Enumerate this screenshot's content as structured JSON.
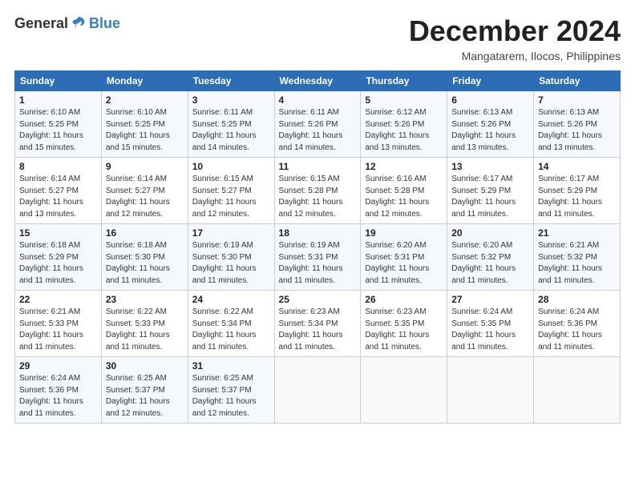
{
  "logo": {
    "general": "General",
    "blue": "Blue"
  },
  "title": "December 2024",
  "location": "Mangatarem, Ilocos, Philippines",
  "weekdays": [
    "Sunday",
    "Monday",
    "Tuesday",
    "Wednesday",
    "Thursday",
    "Friday",
    "Saturday"
  ],
  "weeks": [
    [
      {
        "day": "1",
        "info": "Sunrise: 6:10 AM\nSunset: 5:25 PM\nDaylight: 11 hours\nand 15 minutes."
      },
      {
        "day": "2",
        "info": "Sunrise: 6:10 AM\nSunset: 5:25 PM\nDaylight: 11 hours\nand 15 minutes."
      },
      {
        "day": "3",
        "info": "Sunrise: 6:11 AM\nSunset: 5:25 PM\nDaylight: 11 hours\nand 14 minutes."
      },
      {
        "day": "4",
        "info": "Sunrise: 6:11 AM\nSunset: 5:26 PM\nDaylight: 11 hours\nand 14 minutes."
      },
      {
        "day": "5",
        "info": "Sunrise: 6:12 AM\nSunset: 5:26 PM\nDaylight: 11 hours\nand 13 minutes."
      },
      {
        "day": "6",
        "info": "Sunrise: 6:13 AM\nSunset: 5:26 PM\nDaylight: 11 hours\nand 13 minutes."
      },
      {
        "day": "7",
        "info": "Sunrise: 6:13 AM\nSunset: 5:26 PM\nDaylight: 11 hours\nand 13 minutes."
      }
    ],
    [
      {
        "day": "8",
        "info": "Sunrise: 6:14 AM\nSunset: 5:27 PM\nDaylight: 11 hours\nand 13 minutes."
      },
      {
        "day": "9",
        "info": "Sunrise: 6:14 AM\nSunset: 5:27 PM\nDaylight: 11 hours\nand 12 minutes."
      },
      {
        "day": "10",
        "info": "Sunrise: 6:15 AM\nSunset: 5:27 PM\nDaylight: 11 hours\nand 12 minutes."
      },
      {
        "day": "11",
        "info": "Sunrise: 6:15 AM\nSunset: 5:28 PM\nDaylight: 11 hours\nand 12 minutes."
      },
      {
        "day": "12",
        "info": "Sunrise: 6:16 AM\nSunset: 5:28 PM\nDaylight: 11 hours\nand 12 minutes."
      },
      {
        "day": "13",
        "info": "Sunrise: 6:17 AM\nSunset: 5:29 PM\nDaylight: 11 hours\nand 11 minutes."
      },
      {
        "day": "14",
        "info": "Sunrise: 6:17 AM\nSunset: 5:29 PM\nDaylight: 11 hours\nand 11 minutes."
      }
    ],
    [
      {
        "day": "15",
        "info": "Sunrise: 6:18 AM\nSunset: 5:29 PM\nDaylight: 11 hours\nand 11 minutes."
      },
      {
        "day": "16",
        "info": "Sunrise: 6:18 AM\nSunset: 5:30 PM\nDaylight: 11 hours\nand 11 minutes."
      },
      {
        "day": "17",
        "info": "Sunrise: 6:19 AM\nSunset: 5:30 PM\nDaylight: 11 hours\nand 11 minutes."
      },
      {
        "day": "18",
        "info": "Sunrise: 6:19 AM\nSunset: 5:31 PM\nDaylight: 11 hours\nand 11 minutes."
      },
      {
        "day": "19",
        "info": "Sunrise: 6:20 AM\nSunset: 5:31 PM\nDaylight: 11 hours\nand 11 minutes."
      },
      {
        "day": "20",
        "info": "Sunrise: 6:20 AM\nSunset: 5:32 PM\nDaylight: 11 hours\nand 11 minutes."
      },
      {
        "day": "21",
        "info": "Sunrise: 6:21 AM\nSunset: 5:32 PM\nDaylight: 11 hours\nand 11 minutes."
      }
    ],
    [
      {
        "day": "22",
        "info": "Sunrise: 6:21 AM\nSunset: 5:33 PM\nDaylight: 11 hours\nand 11 minutes."
      },
      {
        "day": "23",
        "info": "Sunrise: 6:22 AM\nSunset: 5:33 PM\nDaylight: 11 hours\nand 11 minutes."
      },
      {
        "day": "24",
        "info": "Sunrise: 6:22 AM\nSunset: 5:34 PM\nDaylight: 11 hours\nand 11 minutes."
      },
      {
        "day": "25",
        "info": "Sunrise: 6:23 AM\nSunset: 5:34 PM\nDaylight: 11 hours\nand 11 minutes."
      },
      {
        "day": "26",
        "info": "Sunrise: 6:23 AM\nSunset: 5:35 PM\nDaylight: 11 hours\nand 11 minutes."
      },
      {
        "day": "27",
        "info": "Sunrise: 6:24 AM\nSunset: 5:35 PM\nDaylight: 11 hours\nand 11 minutes."
      },
      {
        "day": "28",
        "info": "Sunrise: 6:24 AM\nSunset: 5:36 PM\nDaylight: 11 hours\nand 11 minutes."
      }
    ],
    [
      {
        "day": "29",
        "info": "Sunrise: 6:24 AM\nSunset: 5:36 PM\nDaylight: 11 hours\nand 11 minutes."
      },
      {
        "day": "30",
        "info": "Sunrise: 6:25 AM\nSunset: 5:37 PM\nDaylight: 11 hours\nand 12 minutes."
      },
      {
        "day": "31",
        "info": "Sunrise: 6:25 AM\nSunset: 5:37 PM\nDaylight: 11 hours\nand 12 minutes."
      },
      null,
      null,
      null,
      null
    ]
  ]
}
